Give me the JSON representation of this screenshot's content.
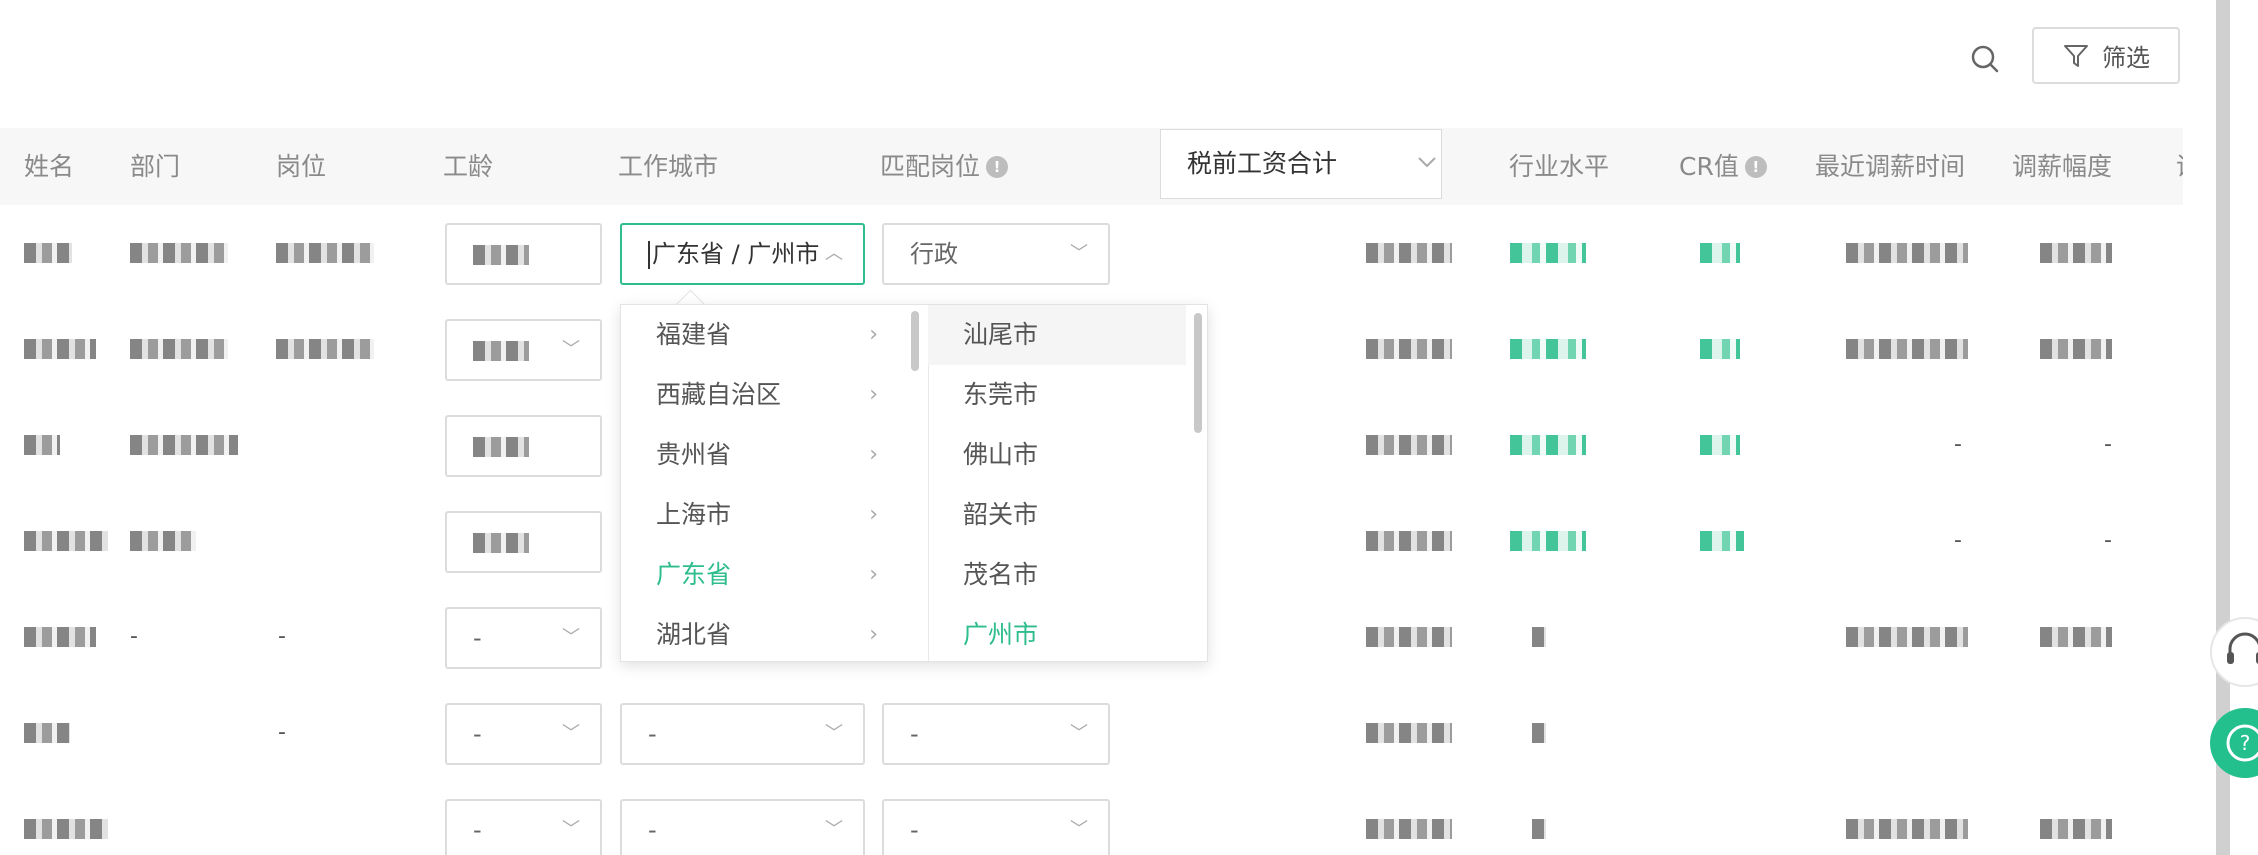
{
  "toolbar": {
    "filter_label": "筛选",
    "search_icon": "search-icon",
    "filter_icon": "filter-icon"
  },
  "table": {
    "headers": [
      "姓名",
      "部门",
      "岗位",
      "工龄",
      "工作城市",
      "匹配岗位",
      "行业水平",
      "CR值",
      "最近调薪时间",
      "调薪幅度",
      "调"
    ],
    "salary_select": "税前工资合计",
    "rows": [
      {
        "tenure": "",
        "city": "广东省 / 广州市",
        "position": "行政",
        "dept": "",
        "role": "",
        "recent": "",
        "range": ""
      },
      {
        "tenure": "",
        "city": "",
        "position": "",
        "dept": "",
        "role": "",
        "recent": "",
        "range": ""
      },
      {
        "tenure": "",
        "city": "",
        "position": "",
        "dept": "",
        "role": "",
        "recent": "-",
        "range": "-"
      },
      {
        "tenure": "",
        "city": "",
        "position": "",
        "dept": "",
        "role": "",
        "recent": "-",
        "range": "-"
      },
      {
        "tenure": "-",
        "city": "",
        "position": "",
        "dept": "-",
        "role": "-",
        "recent": "",
        "range": ""
      },
      {
        "tenure": "-",
        "city": "-",
        "position": "-",
        "dept": "",
        "role": "-",
        "recent": "",
        "range": ""
      },
      {
        "tenure": "-",
        "city": "-",
        "position": "-",
        "dept": "",
        "role": "",
        "recent": "",
        "range": ""
      }
    ]
  },
  "cascader": {
    "provinces": [
      {
        "label": "福建省",
        "selected": false
      },
      {
        "label": "西藏自治区",
        "selected": false
      },
      {
        "label": "贵州省",
        "selected": false
      },
      {
        "label": "上海市",
        "selected": false
      },
      {
        "label": "广东省",
        "selected": true
      },
      {
        "label": "湖北省",
        "selected": false
      }
    ],
    "cities": [
      {
        "label": "汕尾市",
        "selected": false,
        "hover": true
      },
      {
        "label": "东莞市",
        "selected": false,
        "hover": false
      },
      {
        "label": "佛山市",
        "selected": false,
        "hover": false
      },
      {
        "label": "韶关市",
        "selected": false,
        "hover": false
      },
      {
        "label": "茂名市",
        "selected": false,
        "hover": false
      },
      {
        "label": "广州市",
        "selected": true,
        "hover": false
      }
    ]
  },
  "colors": {
    "accent": "#2ebd8e",
    "border": "#dcdcdc",
    "header_bg": "#f7f7f7",
    "help_button": "#23bf8d"
  },
  "float_buttons": {
    "support_icon": "headset-icon",
    "help_icon": "question-chat-icon"
  }
}
